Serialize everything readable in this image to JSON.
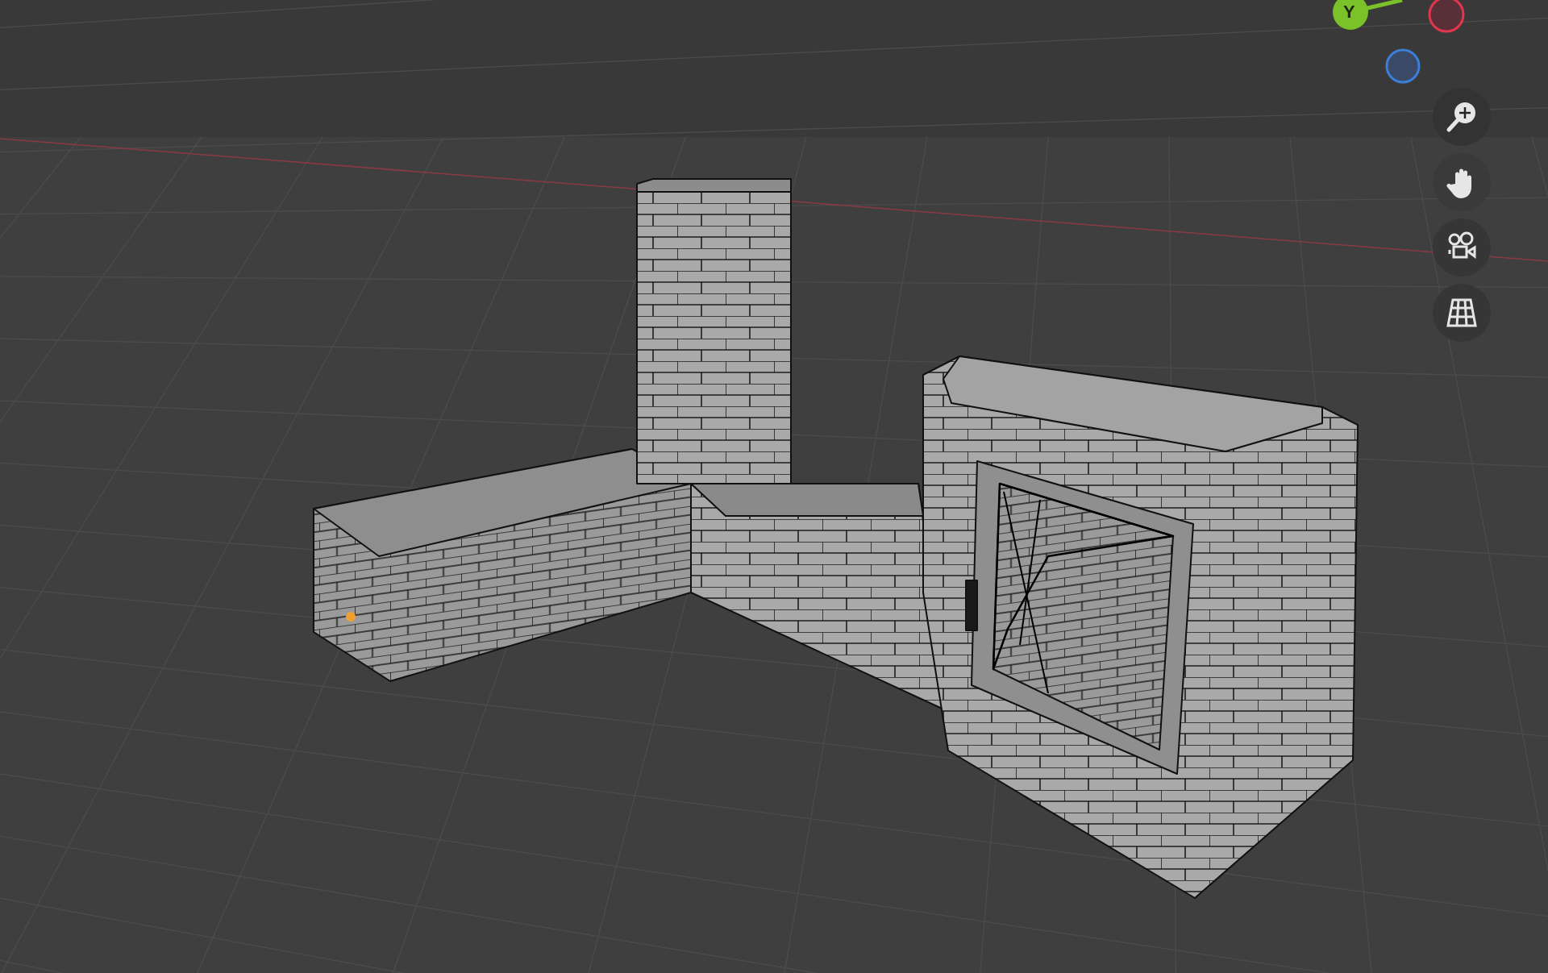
{
  "viewport": {
    "axis_gizmo": {
      "y_label": "Y"
    }
  }
}
